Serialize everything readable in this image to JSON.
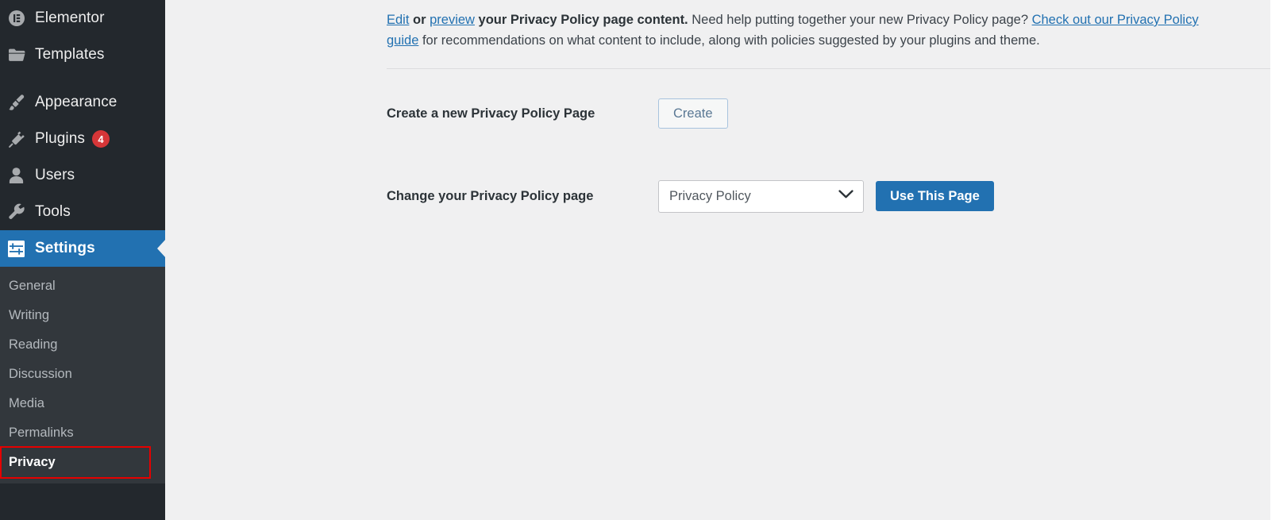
{
  "sidebar": {
    "menu": [
      {
        "label": "Elementor",
        "icon": "elementor-icon",
        "name": "sidebar-item-elementor",
        "badge": null,
        "current": false,
        "gap": false
      },
      {
        "label": "Templates",
        "icon": "folder-icon",
        "name": "sidebar-item-templates",
        "badge": null,
        "current": false,
        "gap": false
      },
      {
        "label": "Appearance",
        "icon": "paintbrush-icon",
        "name": "sidebar-item-appearance",
        "badge": null,
        "current": false,
        "gap": true
      },
      {
        "label": "Plugins",
        "icon": "plug-icon",
        "name": "sidebar-item-plugins",
        "badge": "4",
        "current": false,
        "gap": false
      },
      {
        "label": "Users",
        "icon": "user-icon",
        "name": "sidebar-item-users",
        "badge": null,
        "current": false,
        "gap": false
      },
      {
        "label": "Tools",
        "icon": "wrench-icon",
        "name": "sidebar-item-tools",
        "badge": null,
        "current": false,
        "gap": false
      },
      {
        "label": "Settings",
        "icon": "sliders-icon",
        "name": "sidebar-item-settings",
        "badge": null,
        "current": true,
        "gap": false
      }
    ],
    "submenu": [
      {
        "label": "General",
        "name": "submenu-item-general",
        "current": false,
        "highlighted": false
      },
      {
        "label": "Writing",
        "name": "submenu-item-writing",
        "current": false,
        "highlighted": false
      },
      {
        "label": "Reading",
        "name": "submenu-item-reading",
        "current": false,
        "highlighted": false
      },
      {
        "label": "Discussion",
        "name": "submenu-item-discussion",
        "current": false,
        "highlighted": false
      },
      {
        "label": "Media",
        "name": "submenu-item-media",
        "current": false,
        "highlighted": false
      },
      {
        "label": "Permalinks",
        "name": "submenu-item-permalinks",
        "current": false,
        "highlighted": false
      },
      {
        "label": "Privacy",
        "name": "submenu-item-privacy",
        "current": true,
        "highlighted": true
      }
    ]
  },
  "main": {
    "intro": {
      "link_edit": "Edit",
      "text_or": " or ",
      "link_preview": "preview",
      "text_bold_tail": " your Privacy Policy page content.",
      "text_mid": " Need help putting together your new Privacy Policy page? ",
      "link_guide": "Check out our Privacy Policy guide",
      "text_tail": " for recommendations on what content to include, along with policies suggested by your plugins and theme."
    },
    "create_row": {
      "label": "Create a new Privacy Policy Page",
      "button": "Create"
    },
    "change_row": {
      "label": "Change your Privacy Policy page",
      "select_value": "Privacy Policy",
      "button": "Use This Page"
    }
  },
  "colors": {
    "sidebar_bg": "#23282d",
    "submenu_bg": "#32373c",
    "accent_blue": "#2271b1",
    "badge_red": "#d63638",
    "highlight_red": "#e60000",
    "content_bg": "#f0f0f1"
  }
}
